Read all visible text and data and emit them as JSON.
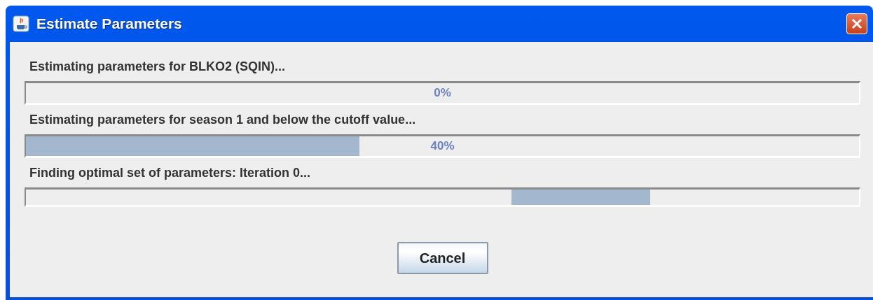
{
  "window": {
    "title": "Estimate Parameters"
  },
  "tasks": [
    {
      "label": "Estimating parameters for BLKO2 (SQIN)...",
      "kind": "determinate",
      "reading": "0%"
    },
    {
      "label": "Estimating parameters for season 1 and below the cutoff value...",
      "kind": "determinate",
      "level": 0.4,
      "reading": "40%"
    },
    {
      "label": "Finding optimal set of parameters: Iteration 0...",
      "kind": "indeterminate"
    }
  ],
  "buttons": [
    {
      "label": "Cancel"
    }
  ]
}
